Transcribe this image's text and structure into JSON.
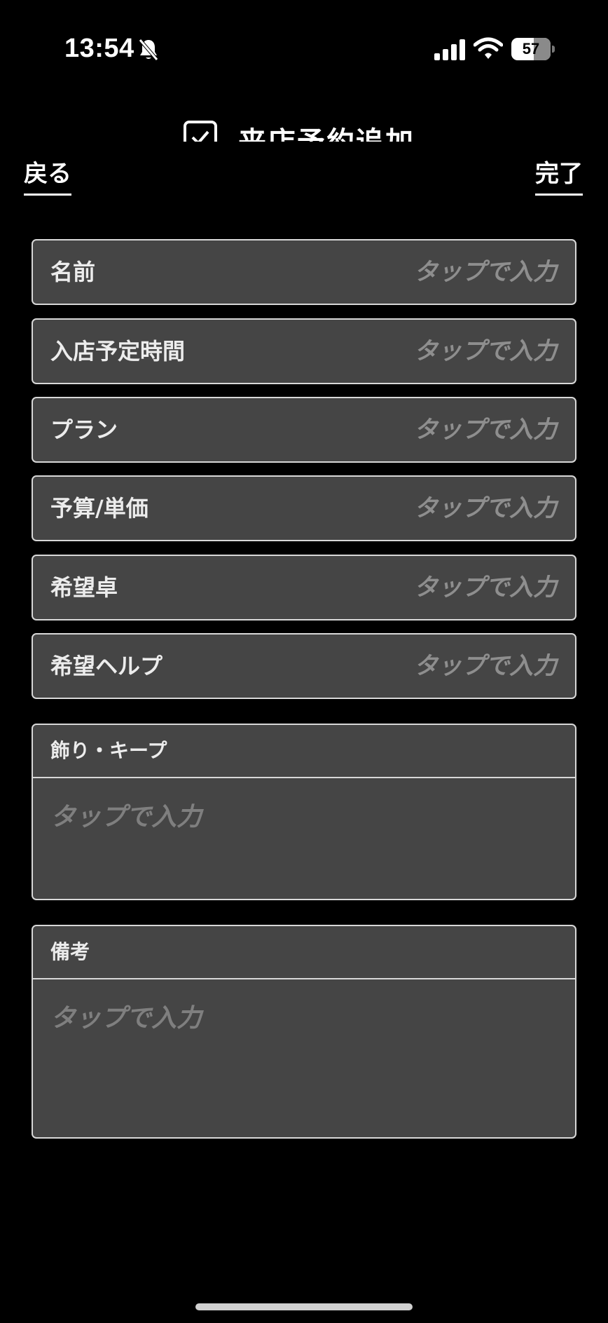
{
  "status_bar": {
    "time": "13:54",
    "battery": "57"
  },
  "header": {
    "title": "来店予約追加",
    "back_label": "戻る",
    "done_label": "完了"
  },
  "form": {
    "fields": [
      {
        "label": "名前",
        "placeholder": "タップで入力"
      },
      {
        "label": "入店予定時間",
        "placeholder": "タップで入力"
      },
      {
        "label": "プラン",
        "placeholder": "タップで入力"
      },
      {
        "label": "予算/単価",
        "placeholder": "タップで入力"
      },
      {
        "label": "希望卓",
        "placeholder": "タップで入力"
      },
      {
        "label": "希望ヘルプ",
        "placeholder": "タップで入力"
      }
    ],
    "blocks": [
      {
        "label": "飾り・キープ",
        "placeholder": "タップで入力"
      },
      {
        "label": "備考",
        "placeholder": "タップで入力"
      }
    ]
  },
  "colors": {
    "background": "#000000",
    "field_background": "#454545",
    "field_border": "#d8d8d8",
    "placeholder": "#8e8e8e"
  }
}
